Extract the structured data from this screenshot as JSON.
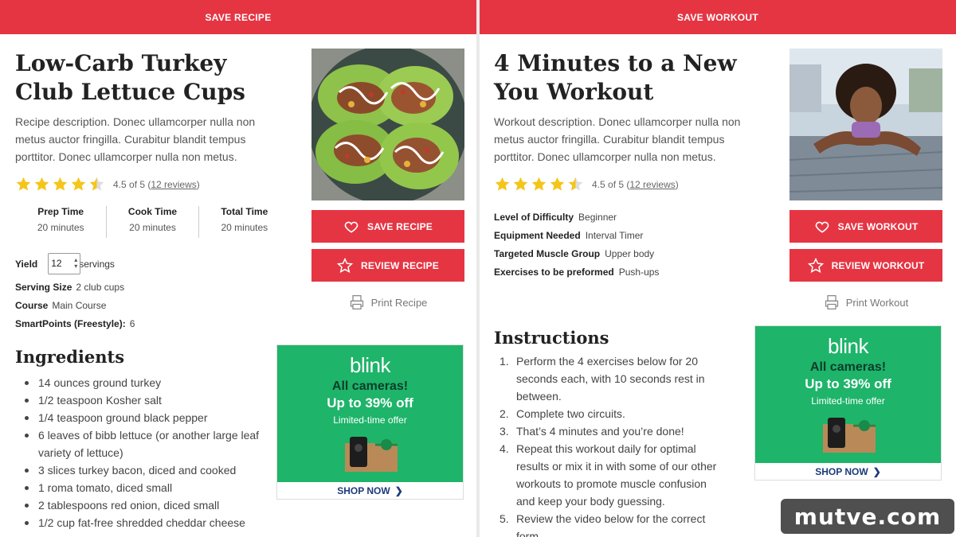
{
  "recipe": {
    "topbar": "SAVE RECIPE",
    "title": "Low-Carb Turkey Club Lettuce Cups",
    "description": "Recipe description. Donec ullamcorper nulla non metus auctor fringilla. Curabitur blandit tempus porttitor. Donec ullamcorper nulla non metus.",
    "rating_text": "4.5 of 5 (",
    "reviews_link": "12 reviews",
    "rating_close": ")",
    "rating_value": 4.5,
    "times": [
      {
        "label": "Prep Time",
        "value": "20 minutes"
      },
      {
        "label": "Cook Time",
        "value": "20 minutes"
      },
      {
        "label": "Total Time",
        "value": "20 minutes"
      }
    ],
    "yield_label": "Yield",
    "yield_value": "12",
    "yield_unit": "servings",
    "serving_size_label": "Serving Size",
    "serving_size_value": "2 club cups",
    "course_label": "Course",
    "course_value": "Main Course",
    "points_label": "SmartPoints (Freestyle):",
    "points_value": "6",
    "save_button": "SAVE RECIPE",
    "review_button": "REVIEW RECIPE",
    "print_label": "Print Recipe",
    "ingredients_heading": "Ingredients",
    "ingredients": [
      "14 ounces ground turkey",
      "1/2 teaspoon Kosher salt",
      "1/4 teaspoon ground black pepper",
      "6 leaves of bibb lettuce (or another large leaf variety of lettuce)",
      "3 slices turkey bacon, diced and cooked",
      "1 roma tomato, diced small",
      "2 tablespoons red onion, diced small",
      "1/2 cup fat-free shredded cheddar cheese"
    ]
  },
  "workout": {
    "topbar": "SAVE WORKOUT",
    "title": "4 Minutes to a New You Workout",
    "description": "Workout description. Donec ullamcorper nulla non metus auctor fringilla. Curabitur blandit tempus porttitor. Donec ullamcorper nulla non metus.",
    "rating_text": "4.5 of 5 (",
    "reviews_link": "12 reviews",
    "rating_close": ")",
    "rating_value": 4.5,
    "details": [
      {
        "label": "Level of Difficulty",
        "value": "Beginner"
      },
      {
        "label": "Equipment Needed",
        "value": "Interval Timer"
      },
      {
        "label": "Targeted Muscle Group",
        "value": "Upper body"
      },
      {
        "label": "Exercises to be preformed",
        "value": "Push-ups"
      }
    ],
    "save_button": "SAVE WORKOUT",
    "review_button": "REVIEW WORKOUT",
    "print_label": "Print Workout",
    "instructions_heading": "Instructions",
    "instructions": [
      {
        "num": "1.",
        "text": "Perform the 4 exercises below for 20 seconds each, with 10 seconds rest in between."
      },
      {
        "num": "2.",
        "text": "Complete two circuits."
      },
      {
        "num": "3.",
        "text": "That’s 4 minutes and you’re done!"
      },
      {
        "num": "4.",
        "text": "Repeat this workout daily for optimal results or mix it in with some of our other workouts to promote muscle confusion and keep your body guessing."
      },
      {
        "num": "5.",
        "text": "Review the video below for the correct form."
      }
    ]
  },
  "ad": {
    "logo": "blink",
    "line1": "All cameras!",
    "line2": "Up to 39% off",
    "line3": "Limited-time offer",
    "cta": "SHOP NOW"
  },
  "watermark": "mutve.com",
  "colors": {
    "accent": "#e53543",
    "star": "#f5c518",
    "ad_green": "#1eb46a"
  }
}
